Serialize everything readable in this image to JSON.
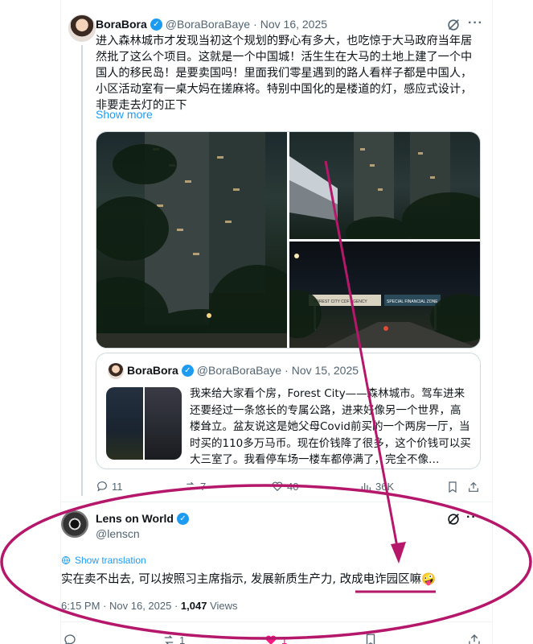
{
  "tweet": {
    "author_name": "BoraBora",
    "author_handle": "@BoraBoraBaye",
    "date": "Nov 16, 2025",
    "text": "进入森林城市才发现当初这个规划的野心有多大，也吃惊于大马政府当年居然批了这么个项目。这就是一个中国城！活生生在大马的土地上建了一个中国人的移民岛！是要卖国吗！里面我们零星遇到的路人看样子都是中国人，小区活动室有一桌大妈在搓麻将。特别中国化的是楼道的灯，感应式设计，非要走去灯的正下",
    "show_more": "Show more",
    "sign_text_1": "FOREST CITY CDF AGENCY",
    "sign_text_2": "SPECIAL FINANCIAL ZONE",
    "reply_count": "11",
    "repost_count": "7",
    "like_count": "40",
    "view_count": "36K"
  },
  "quote": {
    "author_name": "BoraBora",
    "author_handle": "@BoraBoraBaye",
    "date": "Nov 15, 2025",
    "text": "我来给大家看个房，Forest City——森林城市。驾车进来还要经过一条悠长的专属公路，进来好像另一个世界，高楼耸立。盆友说这是她父母Covid前买的一个两房一厅，当时买的110多万马币。现在价钱降了很多，这个价钱可以买大三室了。我看停车场一楼车都停满了，完全不像…"
  },
  "reply": {
    "author_name": "Lens on World",
    "author_handle": "@lenscn",
    "show_translation": "Show translation",
    "text": "实在卖不出去, 可以按照习主席指示, 发展新质生产力, 改成电诈园区嘛🤪",
    "time": "6:15 PM",
    "date": "Nov 16, 2025",
    "views_count": "1,047",
    "views_label": "Views",
    "repost_count": "1",
    "like_count": "1"
  },
  "icons": {
    "verified": "verified-badge-icon",
    "grok": "grok-slash-icon",
    "more": "more-dots-icon",
    "reply": "reply-bubble-icon",
    "repost": "repost-arrows-icon",
    "like": "heart-icon",
    "views": "analytics-bars-icon",
    "bookmark": "bookmark-icon",
    "share": "share-upload-icon",
    "translate": "translate-globe-icon"
  },
  "colors": {
    "annotation": "#b5176a",
    "link": "#1d9bf0",
    "muted": "#536471"
  }
}
